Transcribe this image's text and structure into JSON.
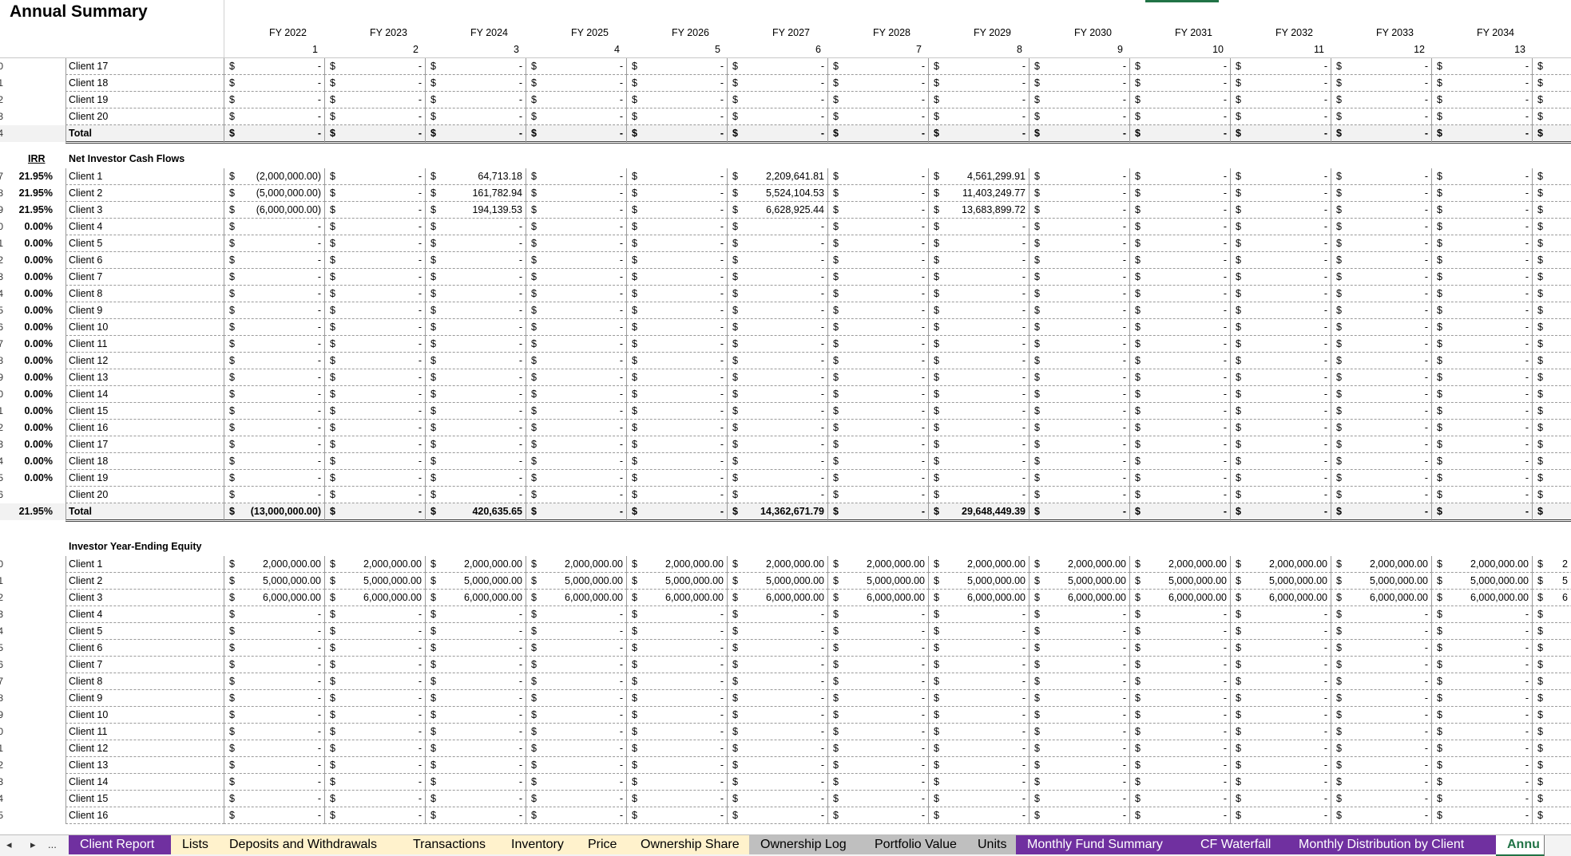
{
  "title": "Annual Summary",
  "fiscal_years": [
    "FY 2022",
    "FY 2023",
    "FY 2024",
    "FY 2025",
    "FY 2026",
    "FY 2027",
    "FY 2028",
    "FY 2029",
    "FY 2030",
    "FY 2031",
    "FY 2032",
    "FY 2033",
    "FY 2034"
  ],
  "year_numbers": [
    "1",
    "2",
    "3",
    "4",
    "5",
    "6",
    "7",
    "8",
    "9",
    "10",
    "11",
    "12",
    "13"
  ],
  "currency_symbol": "$",
  "dash": "-",
  "section1": {
    "rows": [
      {
        "row_no": "0",
        "label": "Client 17",
        "irr": "",
        "values": []
      },
      {
        "row_no": "1",
        "label": "Client 18",
        "irr": "",
        "values": []
      },
      {
        "row_no": "2",
        "label": "Client 19",
        "irr": "",
        "values": []
      },
      {
        "row_no": "3",
        "label": "Client 20",
        "irr": "",
        "values": []
      },
      {
        "row_no": "4",
        "label": "Total",
        "irr": "",
        "values": [],
        "total": true
      }
    ]
  },
  "section2": {
    "irr_header": "IRR",
    "header": "Net Investor Cash Flows",
    "rows": [
      {
        "row_no": "7",
        "label": "Client 1",
        "irr": "21.95%",
        "values": {
          "0": "(2,000,000.00)",
          "2": "64,713.18",
          "5": "2,209,641.81",
          "7": "4,561,299.91"
        }
      },
      {
        "row_no": "8",
        "label": "Client 2",
        "irr": "21.95%",
        "values": {
          "0": "(5,000,000.00)",
          "2": "161,782.94",
          "5": "5,524,104.53",
          "7": "11,403,249.77"
        }
      },
      {
        "row_no": "9",
        "label": "Client 3",
        "irr": "21.95%",
        "values": {
          "0": "(6,000,000.00)",
          "2": "194,139.53",
          "5": "6,628,925.44",
          "7": "13,683,899.72"
        }
      },
      {
        "row_no": "0",
        "label": "Client 4",
        "irr": "0.00%",
        "values": {}
      },
      {
        "row_no": "1",
        "label": "Client 5",
        "irr": "0.00%",
        "values": {}
      },
      {
        "row_no": "2",
        "label": "Client 6",
        "irr": "0.00%",
        "values": {}
      },
      {
        "row_no": "3",
        "label": "Client 7",
        "irr": "0.00%",
        "values": {}
      },
      {
        "row_no": "4",
        "label": "Client 8",
        "irr": "0.00%",
        "values": {}
      },
      {
        "row_no": "5",
        "label": "Client 9",
        "irr": "0.00%",
        "values": {}
      },
      {
        "row_no": "6",
        "label": "Client 10",
        "irr": "0.00%",
        "values": {}
      },
      {
        "row_no": "7",
        "label": "Client 11",
        "irr": "0.00%",
        "values": {}
      },
      {
        "row_no": "8",
        "label": "Client 12",
        "irr": "0.00%",
        "values": {}
      },
      {
        "row_no": "9",
        "label": "Client 13",
        "irr": "0.00%",
        "values": {}
      },
      {
        "row_no": "0",
        "label": "Client 14",
        "irr": "0.00%",
        "values": {}
      },
      {
        "row_no": "1",
        "label": "Client 15",
        "irr": "0.00%",
        "values": {}
      },
      {
        "row_no": "2",
        "label": "Client 16",
        "irr": "0.00%",
        "values": {}
      },
      {
        "row_no": "3",
        "label": "Client 17",
        "irr": "0.00%",
        "values": {}
      },
      {
        "row_no": "4",
        "label": "Client 18",
        "irr": "0.00%",
        "values": {}
      },
      {
        "row_no": "5",
        "label": "Client 19",
        "irr": "0.00%",
        "values": {}
      },
      {
        "row_no": "6",
        "label": "Client 20",
        "irr": "",
        "values": {}
      },
      {
        "row_no": "",
        "label": "Total",
        "irr": "21.95%",
        "values": {
          "0": "(13,000,000.00)",
          "2": "420,635.65",
          "5": "14,362,671.79",
          "7": "29,648,449.39"
        },
        "total": true
      }
    ]
  },
  "section3": {
    "header": "Investor Year-Ending Equity",
    "rows": [
      {
        "row_no": "0",
        "label": "Client 1",
        "fill": "2,000,000.00"
      },
      {
        "row_no": "1",
        "label": "Client 2",
        "fill": "5,000,000.00"
      },
      {
        "row_no": "2",
        "label": "Client 3",
        "fill": "6,000,000.00"
      },
      {
        "row_no": "3",
        "label": "Client 4",
        "fill": ""
      },
      {
        "row_no": "4",
        "label": "Client 5",
        "fill": ""
      },
      {
        "row_no": "5",
        "label": "Client 6",
        "fill": ""
      },
      {
        "row_no": "6",
        "label": "Client 7",
        "fill": ""
      },
      {
        "row_no": "7",
        "label": "Client 8",
        "fill": ""
      },
      {
        "row_no": "8",
        "label": "Client 9",
        "fill": ""
      },
      {
        "row_no": "9",
        "label": "Client 10",
        "fill": ""
      },
      {
        "row_no": "0",
        "label": "Client 11",
        "fill": ""
      },
      {
        "row_no": "1",
        "label": "Client 12",
        "fill": ""
      },
      {
        "row_no": "2",
        "label": "Client 13",
        "fill": ""
      },
      {
        "row_no": "3",
        "label": "Client 14",
        "fill": ""
      },
      {
        "row_no": "4",
        "label": "Client 15",
        "fill": ""
      },
      {
        "row_no": "5",
        "label": "Client 16",
        "fill": ""
      }
    ],
    "overflow_right": [
      "2",
      "5",
      "6"
    ]
  },
  "tabbar": {
    "nav": [
      "◂",
      "▸",
      "..."
    ],
    "tabs": [
      {
        "label": "Client Report",
        "style": "purple"
      },
      {
        "label": "Lists",
        "style": "yellow"
      },
      {
        "label": "Deposits and Withdrawals",
        "style": "yellow"
      },
      {
        "label": "Transactions",
        "style": "yellow"
      },
      {
        "label": "Inventory",
        "style": "yellow"
      },
      {
        "label": "Price",
        "style": "yellow"
      },
      {
        "label": "Ownership Share",
        "style": "yellow"
      },
      {
        "label": "Ownership Log",
        "style": "grey"
      },
      {
        "label": "Portfolio Value",
        "style": "grey"
      },
      {
        "label": "Units",
        "style": "grey"
      },
      {
        "label": "Monthly Fund Summary",
        "style": "purple"
      },
      {
        "label": "CF Waterfall",
        "style": "purple"
      },
      {
        "label": "Monthly Distribution by Client",
        "style": "purple"
      },
      {
        "label": "Annu",
        "style": "active"
      }
    ]
  }
}
